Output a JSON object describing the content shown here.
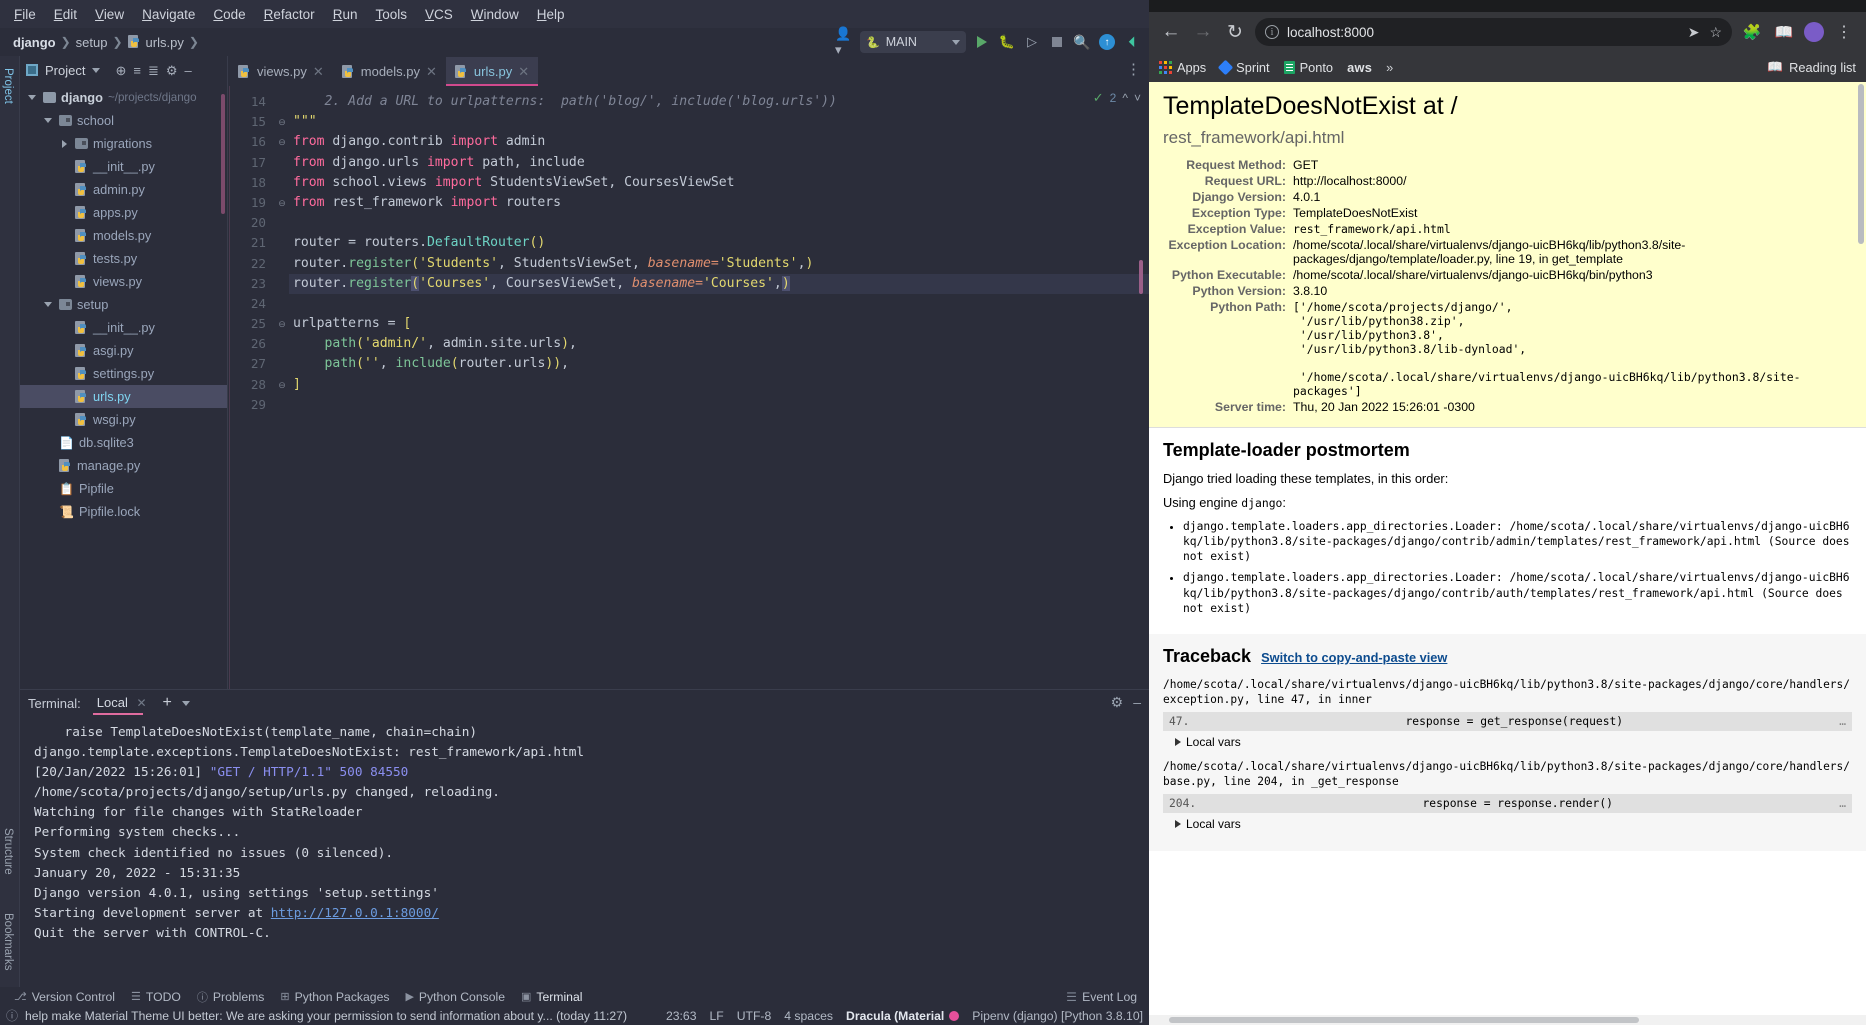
{
  "ide": {
    "menu": [
      "File",
      "Edit",
      "View",
      "Navigate",
      "Code",
      "Refactor",
      "Run",
      "Tools",
      "VCS",
      "Window",
      "Help"
    ],
    "breadcrumb": [
      "django",
      "setup",
      "urls.py"
    ],
    "run_config": "MAIN",
    "project_panel": {
      "title": "Project",
      "tool_labels": [
        "Project",
        "Structure",
        "Bookmarks"
      ],
      "tree": [
        {
          "label": "django",
          "path": "~/projects/django",
          "kind": "folder",
          "depth": 0,
          "twisty": "down",
          "bold": true
        },
        {
          "label": "school",
          "path": "",
          "kind": "module",
          "depth": 1,
          "twisty": "down",
          "bold": false
        },
        {
          "label": "migrations",
          "path": "",
          "kind": "module",
          "depth": 2,
          "twisty": "right",
          "bold": false
        },
        {
          "label": "__init__.py",
          "path": "",
          "kind": "py",
          "depth": 2,
          "twisty": "",
          "bold": false
        },
        {
          "label": "admin.py",
          "path": "",
          "kind": "py",
          "depth": 2,
          "twisty": "",
          "bold": false
        },
        {
          "label": "apps.py",
          "path": "",
          "kind": "py",
          "depth": 2,
          "twisty": "",
          "bold": false
        },
        {
          "label": "models.py",
          "path": "",
          "kind": "py",
          "depth": 2,
          "twisty": "",
          "bold": false
        },
        {
          "label": "tests.py",
          "path": "",
          "kind": "py",
          "depth": 2,
          "twisty": "",
          "bold": false
        },
        {
          "label": "views.py",
          "path": "",
          "kind": "py",
          "depth": 2,
          "twisty": "",
          "bold": false
        },
        {
          "label": "setup",
          "path": "",
          "kind": "module",
          "depth": 1,
          "twisty": "down",
          "bold": false
        },
        {
          "label": "__init__.py",
          "path": "",
          "kind": "py",
          "depth": 2,
          "twisty": "",
          "bold": false
        },
        {
          "label": "asgi.py",
          "path": "",
          "kind": "py",
          "depth": 2,
          "twisty": "",
          "bold": false
        },
        {
          "label": "settings.py",
          "path": "",
          "kind": "py",
          "depth": 2,
          "twisty": "",
          "bold": false
        },
        {
          "label": "urls.py",
          "path": "",
          "kind": "py",
          "depth": 2,
          "twisty": "",
          "bold": false,
          "selected": true
        },
        {
          "label": "wsgi.py",
          "path": "",
          "kind": "py",
          "depth": 2,
          "twisty": "",
          "bold": false
        },
        {
          "label": "db.sqlite3",
          "path": "",
          "kind": "file",
          "depth": 1,
          "twisty": "",
          "bold": false
        },
        {
          "label": "manage.py",
          "path": "",
          "kind": "py",
          "depth": 1,
          "twisty": "",
          "bold": false
        },
        {
          "label": "Pipfile",
          "path": "",
          "kind": "pipfile",
          "depth": 1,
          "twisty": "",
          "bold": false
        },
        {
          "label": "Pipfile.lock",
          "path": "",
          "kind": "lock",
          "depth": 1,
          "twisty": "",
          "bold": false
        }
      ]
    },
    "editor": {
      "tabs": [
        {
          "label": "views.py",
          "active": false
        },
        {
          "label": "models.py",
          "active": false
        },
        {
          "label": "urls.py",
          "active": true
        }
      ],
      "inspection_count": "2",
      "first_line_number": 14,
      "lines": [
        {
          "n": 14,
          "segments": [
            {
              "t": "    2. Add a URL to urlpatterns:  path('blog/', include('blog.urls'))",
              "c": "cm"
            }
          ]
        },
        {
          "n": 15,
          "segments": [
            {
              "t": "\"\"\"",
              "c": "s"
            }
          ],
          "fold": "end"
        },
        {
          "n": 16,
          "segments": [
            {
              "t": "from ",
              "c": "kw"
            },
            {
              "t": "django.contrib ",
              "c": "plain"
            },
            {
              "t": "import ",
              "c": "kw"
            },
            {
              "t": "admin",
              "c": "plain"
            }
          ],
          "fold": "start"
        },
        {
          "n": 17,
          "segments": [
            {
              "t": "from ",
              "c": "kw"
            },
            {
              "t": "django.urls ",
              "c": "plain"
            },
            {
              "t": "import ",
              "c": "kw"
            },
            {
              "t": "path, include",
              "c": "plain"
            }
          ]
        },
        {
          "n": 18,
          "segments": [
            {
              "t": "from ",
              "c": "kw"
            },
            {
              "t": "school.views ",
              "c": "plain"
            },
            {
              "t": "import ",
              "c": "kw"
            },
            {
              "t": "StudentsViewSet, CoursesViewSet",
              "c": "plain"
            }
          ]
        },
        {
          "n": 19,
          "segments": [
            {
              "t": "from ",
              "c": "kw"
            },
            {
              "t": "rest_framework ",
              "c": "plain"
            },
            {
              "t": "import ",
              "c": "kw"
            },
            {
              "t": "routers",
              "c": "plain"
            }
          ],
          "fold": "end"
        },
        {
          "n": 20,
          "segments": []
        },
        {
          "n": 21,
          "segments": [
            {
              "t": "router = routers.",
              "c": "plain"
            },
            {
              "t": "DefaultRouter",
              "c": "cls"
            },
            {
              "t": "()",
              "c": "brk"
            }
          ]
        },
        {
          "n": 22,
          "segments": [
            {
              "t": "router.",
              "c": "plain"
            },
            {
              "t": "register",
              "c": "fn"
            },
            {
              "t": "(",
              "c": "brk"
            },
            {
              "t": "'Students'",
              "c": "s"
            },
            {
              "t": ", StudentsViewSet, ",
              "c": "plain"
            },
            {
              "t": "basename=",
              "c": "kwarg"
            },
            {
              "t": "'Students'",
              "c": "s"
            },
            {
              "t": ",",
              "c": "plain"
            },
            {
              "t": ")",
              "c": "brk"
            }
          ]
        },
        {
          "n": 23,
          "current": true,
          "segments": [
            {
              "t": "router.",
              "c": "plain"
            },
            {
              "t": "register",
              "c": "fn"
            },
            {
              "t": "(",
              "c": "brk sel-tok"
            },
            {
              "t": "'Courses'",
              "c": "s"
            },
            {
              "t": ", CoursesViewSet, ",
              "c": "plain"
            },
            {
              "t": "basename=",
              "c": "kwarg"
            },
            {
              "t": "'Courses'",
              "c": "s"
            },
            {
              "t": ",",
              "c": "plain"
            },
            {
              "t": ")",
              "c": "brk sel-tok"
            }
          ]
        },
        {
          "n": 24,
          "segments": []
        },
        {
          "n": 25,
          "segments": [
            {
              "t": "urlpatterns = ",
              "c": "plain"
            },
            {
              "t": "[",
              "c": "brk"
            }
          ],
          "fold": "start"
        },
        {
          "n": 26,
          "segments": [
            {
              "t": "    ",
              "c": "plain"
            },
            {
              "t": "path",
              "c": "fn"
            },
            {
              "t": "(",
              "c": "brk"
            },
            {
              "t": "'admin/'",
              "c": "s"
            },
            {
              "t": ", admin.site.urls",
              "c": "plain"
            },
            {
              "t": ")",
              "c": "brk"
            },
            {
              "t": ",",
              "c": "plain"
            }
          ]
        },
        {
          "n": 27,
          "segments": [
            {
              "t": "    ",
              "c": "plain"
            },
            {
              "t": "path",
              "c": "fn"
            },
            {
              "t": "(",
              "c": "brk"
            },
            {
              "t": "''",
              "c": "s"
            },
            {
              "t": ", ",
              "c": "plain"
            },
            {
              "t": "include",
              "c": "fn"
            },
            {
              "t": "(",
              "c": "brk"
            },
            {
              "t": "router.urls",
              "c": "plain"
            },
            {
              "t": ")",
              "c": "brk"
            },
            {
              "t": ")",
              "c": "brk"
            },
            {
              "t": ",",
              "c": "plain"
            }
          ]
        },
        {
          "n": 28,
          "segments": [
            {
              "t": "]",
              "c": "brk"
            }
          ],
          "fold": "end"
        },
        {
          "n": 29,
          "segments": []
        }
      ]
    },
    "terminal": {
      "label": "Terminal:",
      "tab": "Local",
      "lines": [
        [
          {
            "t": "    raise TemplateDoesNotExist(template_name, chain=chain)",
            "c": ""
          }
        ],
        [
          {
            "t": "django.template.exceptions.TemplateDoesNotExist: rest_framework/api.html",
            "c": ""
          }
        ],
        [
          {
            "t": "[20/Jan/2022 15:26:01] ",
            "c": ""
          },
          {
            "t": "\"GET / HTTP/1.1\" 500 84550",
            "c": "tm-b"
          }
        ],
        [
          {
            "t": "/home/scota/projects/django/setup/urls.py changed, reloading.",
            "c": ""
          }
        ],
        [
          {
            "t": "Watching for file changes with StatReloader",
            "c": ""
          }
        ],
        [
          {
            "t": "Performing system checks...",
            "c": ""
          }
        ],
        [
          {
            "t": "",
            "c": ""
          }
        ],
        [
          {
            "t": "System check identified no issues (0 silenced).",
            "c": ""
          }
        ],
        [
          {
            "t": "January 20, 2022 - 15:31:35",
            "c": ""
          }
        ],
        [
          {
            "t": "Django version 4.0.1, using settings 'setup.settings'",
            "c": ""
          }
        ],
        [
          {
            "t": "Starting development server at ",
            "c": ""
          },
          {
            "t": "http://127.0.0.1:8000/",
            "c": "tm-link"
          }
        ],
        [
          {
            "t": "Quit the server with CONTROL-C.",
            "c": ""
          }
        ]
      ]
    },
    "bottom_bar": {
      "items": [
        "Version Control",
        "TODO",
        "Problems",
        "Python Packages",
        "Python Console",
        "Terminal"
      ],
      "active": "Terminal",
      "event_log": "Event Log"
    },
    "status_bar": {
      "message": "help make Material Theme UI better: We are asking your permission to send information about y... (today 11:27)",
      "caret": "23:63",
      "line_sep": "LF",
      "encoding": "UTF-8",
      "indent": "4 spaces",
      "theme": "Dracula (Material",
      "interpreter": "Pipenv (django) [Python 3.8.10]"
    }
  },
  "browser": {
    "url": "localhost:8000",
    "bookmarks": [
      "Apps",
      "Sprint",
      "Ponto",
      "aws"
    ],
    "overflow": "»",
    "reading_list": "Reading list",
    "error_page": {
      "title": "TemplateDoesNotExist at /",
      "subtitle": "rest_framework/api.html",
      "summary": [
        {
          "label": "Request Method:",
          "value": "GET",
          "mono": false
        },
        {
          "label": "Request URL:",
          "value": "http://localhost:8000/",
          "mono": false
        },
        {
          "label": "Django Version:",
          "value": "4.0.1",
          "mono": false
        },
        {
          "label": "Exception Type:",
          "value": "TemplateDoesNotExist",
          "mono": false
        },
        {
          "label": "Exception Value:",
          "value": "rest_framework/api.html",
          "mono": true
        },
        {
          "label": "Exception Location:",
          "value": "/home/scota/.local/share/virtualenvs/django-uicBH6kq/lib/python3.8/site-packages/django/template/loader.py, line 19, in get_template",
          "mono": false
        },
        {
          "label": "Python Executable:",
          "value": "/home/scota/.local/share/virtualenvs/django-uicBH6kq/bin/python3",
          "mono": false
        },
        {
          "label": "Python Version:",
          "value": "3.8.10",
          "mono": false
        },
        {
          "label": "Python Path:",
          "value": "['/home/scota/projects/django/',\n '/usr/lib/python38.zip',\n '/usr/lib/python3.8',\n '/usr/lib/python3.8/lib-dynload',\n\n '/home/scota/.local/share/virtualenvs/django-uicBH6kq/lib/python3.8/site-packages']",
          "mono": true
        },
        {
          "label": "Server time:",
          "value": "Thu, 20 Jan 2022 15:26:01 -0300",
          "mono": false
        }
      ],
      "postmortem": {
        "heading": "Template-loader postmortem",
        "intro": "Django tried loading these templates, in this order:",
        "engine_line_prefix": "Using engine ",
        "engine_name": "django",
        "engine_colon": ":",
        "attempts": [
          "django.template.loaders.app_directories.Loader: /home/scota/.local/share/virtualenvs/django-uicBH6kq/lib/python3.8/site-packages/django/contrib/admin/templates/rest_framework/api.html (Source does not exist)",
          "django.template.loaders.app_directories.Loader: /home/scota/.local/share/virtualenvs/django-uicBH6kq/lib/python3.8/site-packages/django/contrib/auth/templates/rest_framework/api.html (Source does not exist)"
        ]
      },
      "traceback": {
        "heading": "Traceback",
        "switch_link": "Switch to copy-and-paste view",
        "frames": [
          {
            "path": "/home/scota/.local/share/virtualenvs/django-uicBH6kq/lib/python3.8/site-packages/django/core/handlers/exception.py, line 47, in inner",
            "lineno": "47.",
            "code": "response = get_response(request)",
            "dots": "…",
            "local_vars": "Local vars"
          },
          {
            "path": "/home/scota/.local/share/virtualenvs/django-uicBH6kq/lib/python3.8/site-packages/django/core/handlers/base.py, line 204, in _get_response",
            "lineno": "204.",
            "code": "response = response.render()",
            "dots": "…",
            "local_vars": "Local vars"
          }
        ]
      }
    }
  }
}
